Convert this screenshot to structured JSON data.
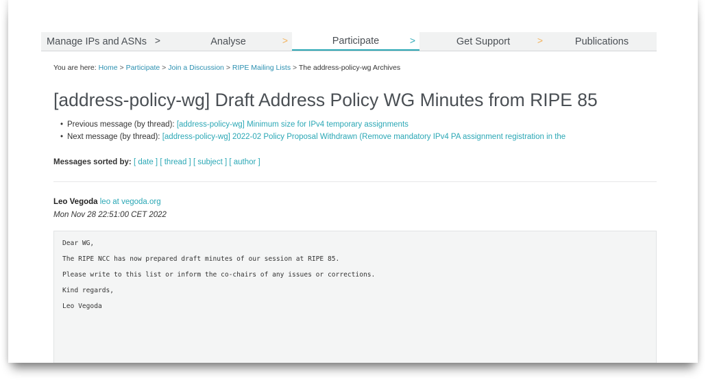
{
  "nav": {
    "items": [
      {
        "label": "Manage IPs and ASNs",
        "chevron": ">"
      },
      {
        "label": "Analyse",
        "chevron": ">"
      },
      {
        "label": "Participate",
        "chevron": ">"
      },
      {
        "label": "Get Support",
        "chevron": ">"
      },
      {
        "label": "Publications",
        "chevron": ""
      }
    ],
    "active": "Participate"
  },
  "breadcrumb": {
    "prefix": "You are here:",
    "items": [
      "Home",
      "Participate",
      "Join a Discussion",
      "RIPE Mailing Lists"
    ],
    "current": "The address-policy-wg Archives",
    "separator": ">"
  },
  "page_title": "[address-policy-wg] Draft Address Policy WG Minutes from RIPE 85",
  "thread_nav": {
    "previous_label": "Previous message (by thread):",
    "previous_link": "[address-policy-wg] Minimum size for IPv4 temporary assignments",
    "next_label": "Next message (by thread):",
    "next_link": "[address-policy-wg] 2022-02 Policy Proposal Withdrawn (Remove mandatory IPv4 PA assignment registration in the"
  },
  "sort": {
    "label": "Messages sorted by:",
    "options": [
      "[ date ]",
      "[ thread ]",
      "[ subject ]",
      "[ author ]"
    ]
  },
  "message": {
    "author_name": "Leo Vegoda",
    "author_email": "leo at vegoda.org",
    "date": "Mon Nov 28 22:51:00 CET 2022",
    "body_lines": [
      "Dear WG,",
      "The RIPE NCC has now prepared draft minutes of our session at RIPE 85.",
      "Please write to this list or inform the co-chairs of any issues or corrections.",
      "Kind regards,",
      "Leo Vegoda"
    ]
  },
  "colors": {
    "link": "#2aa7b5",
    "active_tab_border": "#2aa7b5",
    "nav_chevron": "#f2b25c",
    "heading": "#4a4f54"
  }
}
